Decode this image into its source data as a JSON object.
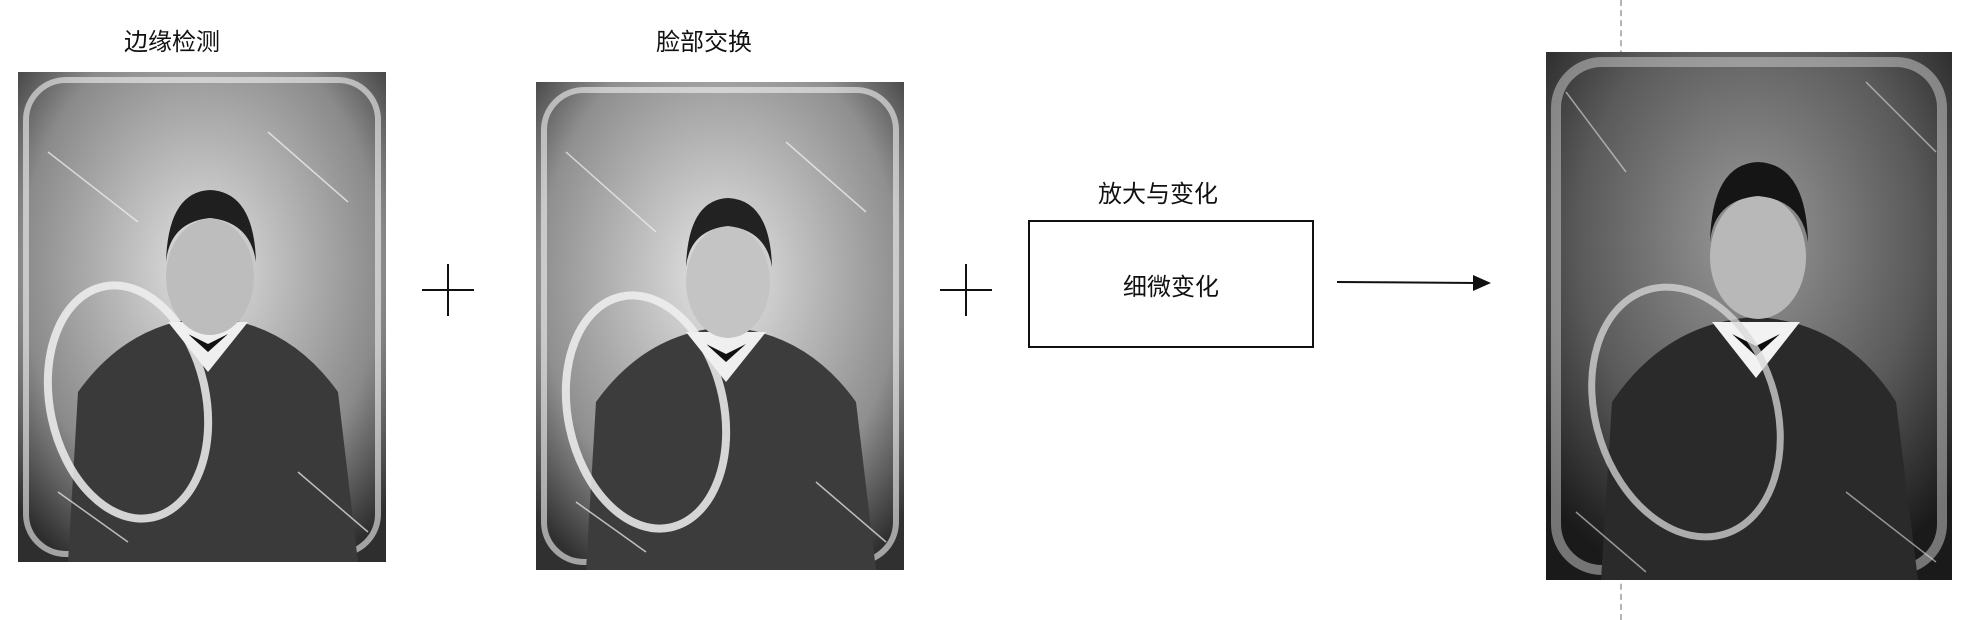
{
  "labels": {
    "step1": "边缘检测",
    "step2": "脸部交换",
    "step3_title": "放大与变化",
    "step3_box": "细微变化"
  },
  "images": [
    {
      "name": "edge-detection-portrait",
      "description": "damaged daguerreotype portrait of a man (input)"
    },
    {
      "name": "face-swap-portrait",
      "description": "damaged daguerreotype portrait with swapped face"
    },
    {
      "name": "result-portrait",
      "description": "enhanced portrait output"
    }
  ],
  "colors": {
    "stroke": "#111111",
    "divider": "#b5b5b5",
    "photo_light": "#d8d8d8",
    "photo_dark": "#2a2a2a"
  }
}
